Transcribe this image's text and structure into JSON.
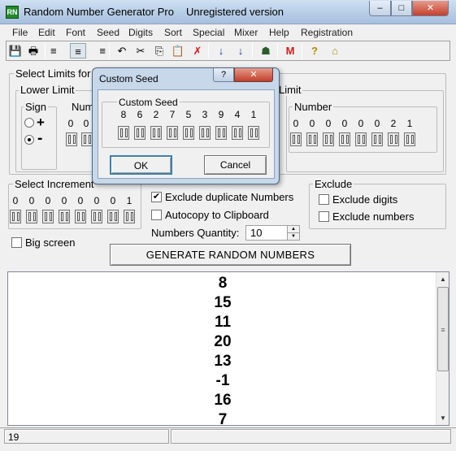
{
  "window": {
    "title": "Random Number Generator Pro",
    "status": "Unregistered version",
    "icon_label": "RN",
    "min_symbol": "‒",
    "max_symbol": "□",
    "close_symbol": "✕"
  },
  "menu": [
    "File",
    "Edit",
    "Font",
    "Seed",
    "Digits",
    "Sort",
    "Special",
    "Mixer",
    "Help",
    "Registration"
  ],
  "toolbar": {
    "icons": [
      "save-icon",
      "print-icon",
      "align-left-icon",
      "align-center-icon",
      "align-right-icon",
      "undo-icon",
      "cut-icon",
      "copy-icon",
      "paste-icon",
      "delete-icon",
      "sort-ascending-icon",
      "sort-descending-icon",
      "mixer-icon",
      "m-icon",
      "help-icon",
      "home-icon"
    ],
    "glyphs": {
      "save": "💾",
      "print": "🖶",
      "align_left": "≡",
      "align_center": "≡",
      "align_right": "≡",
      "undo": "↶",
      "cut": "✂",
      "copy": "⎘",
      "paste": "📋",
      "delete": "✗",
      "sort_asc": "↓",
      "sort_desc": "↓",
      "mixer": "☗",
      "m": "M",
      "help": "?",
      "home": "⌂"
    }
  },
  "limits": {
    "group_label": "Select Limits for",
    "lower_label": "Lower Limit",
    "sign_label": "Sign",
    "plus": "+",
    "minus": "-",
    "number_label_lower": "Numb",
    "lower_digits": [
      "0",
      "0"
    ],
    "upper_label": "Limit",
    "number_label": "Number",
    "upper_digits": [
      "0",
      "0",
      "0",
      "0",
      "0",
      "0",
      "2",
      "1"
    ]
  },
  "increment": {
    "label": "Select Increment",
    "digits": [
      "0",
      "0",
      "0",
      "0",
      "0",
      "0",
      "0",
      "1"
    ]
  },
  "options": {
    "exclude_duplicates": {
      "label": "Exclude duplicate Numbers",
      "checked": true
    },
    "autocopy": {
      "label": "Autocopy to Clipboard",
      "checked": false
    },
    "quantity_label": "Numbers Quantity:",
    "quantity_value": "10",
    "big_screen": {
      "label": "Big screen",
      "checked": false
    }
  },
  "exclude": {
    "label": "Exclude",
    "digits_label": "Exclude digits",
    "numbers_label": "Exclude numbers"
  },
  "generate_button": "GENERATE RANDOM NUMBERS",
  "output": [
    "8",
    "15",
    "11",
    "20",
    "13",
    "-1",
    "16",
    "7"
  ],
  "scroll": {
    "up": "▲",
    "down": "▼",
    "grip": "≡"
  },
  "statusbar": {
    "count": "19"
  },
  "dialog": {
    "title": "Custom Seed",
    "help_symbol": "?",
    "close_symbol": "✕",
    "group_label": "Custom Seed",
    "digits": [
      "8",
      "6",
      "2",
      "7",
      "5",
      "3",
      "9",
      "4",
      "1"
    ],
    "ok_label": "OK",
    "cancel_label": "Cancel"
  },
  "colors": {
    "titlebar": "#b9cfe8",
    "close": "#c4402c",
    "window_bg": "#f0f0f0"
  }
}
